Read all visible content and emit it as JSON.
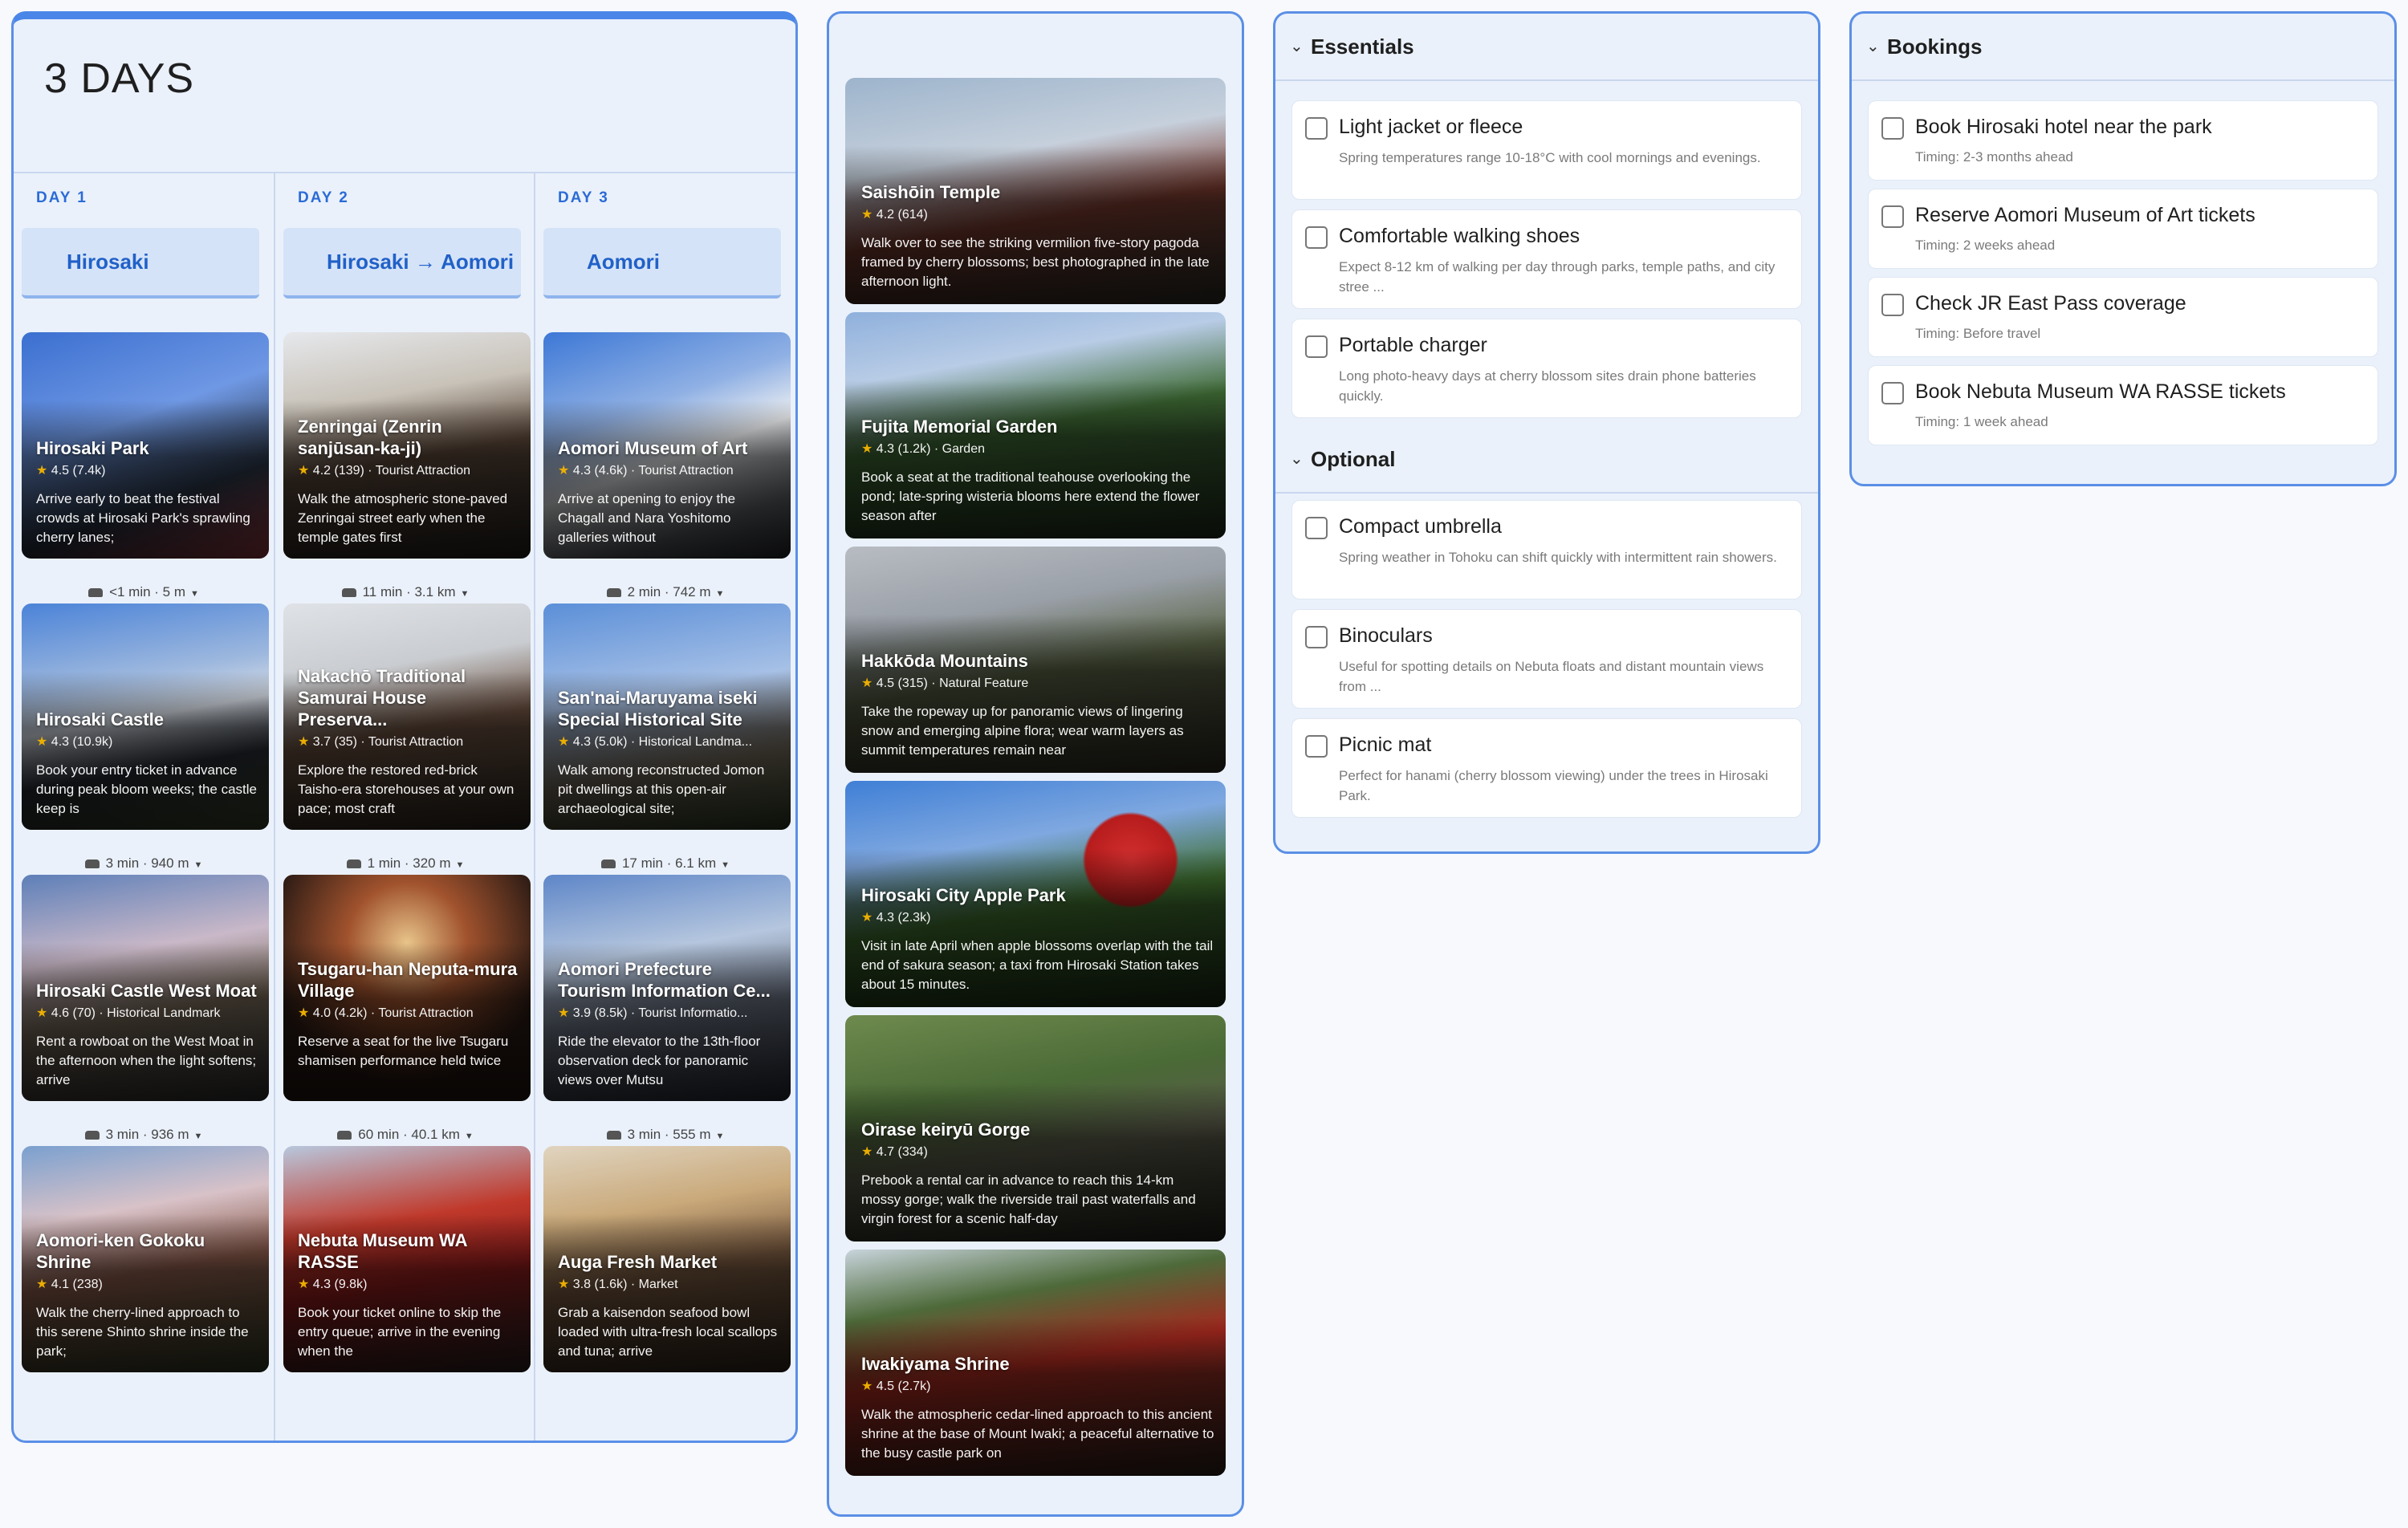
{
  "trip": {
    "title": "3 DAYS",
    "days": [
      {
        "label": "DAY 1",
        "city": "Hirosaki",
        "cards": [
          {
            "title": "Hirosaki Park",
            "rating": "4.5",
            "reviews": "(7.4k)",
            "category": "",
            "desc": "Arrive early to beat the festival crowds at Hirosaki Park's sprawling cherry lanes;"
          },
          {
            "title": "Hirosaki Castle",
            "rating": "4.3",
            "reviews": "(10.9k)",
            "category": "",
            "desc": "Book your entry ticket in advance during peak bloom weeks; the castle keep is"
          },
          {
            "title": "Hirosaki Castle West Moat",
            "rating": "4.6",
            "reviews": "(70)",
            "category": "Historical Landmark",
            "desc": "Rent a rowboat on the West Moat in the afternoon when the light softens; arrive"
          },
          {
            "title": "Aomori-ken Gokoku Shrine",
            "rating": "4.1",
            "reviews": "(238)",
            "category": "",
            "desc": "Walk the cherry-lined approach to this serene Shinto shrine inside the park;"
          }
        ],
        "travel": [
          "<1 min · 5 m",
          "3 min · 940 m",
          "3 min · 936 m"
        ]
      },
      {
        "label": "DAY 2",
        "city": "Hirosaki → Aomori",
        "cards": [
          {
            "title": "Zenringai (Zenrin sanjūsan-ka-ji)",
            "rating": "4.2",
            "reviews": "(139)",
            "category": "Tourist Attraction",
            "desc": "Walk the atmospheric stone-paved Zenringai street early when the temple gates first"
          },
          {
            "title": "Nakachō Traditional Samurai House Preserva...",
            "rating": "3.7",
            "reviews": "(35)",
            "category": "Tourist Attraction",
            "desc": "Explore the restored red-brick Taisho-era storehouses at your own pace; most craft"
          },
          {
            "title": "Tsugaru-han Neputa-mura Village",
            "rating": "4.0",
            "reviews": "(4.2k)",
            "category": "Tourist Attraction",
            "desc": "Reserve a seat for the live Tsugaru shamisen performance held twice"
          },
          {
            "title": "Nebuta Museum WA RASSE",
            "rating": "4.3",
            "reviews": "(9.8k)",
            "category": "",
            "desc": "Book your ticket online to skip the entry queue; arrive in the evening when the"
          }
        ],
        "travel": [
          "11 min · 3.1 km",
          "1 min · 320 m",
          "60 min · 40.1 km"
        ]
      },
      {
        "label": "DAY 3",
        "city": "Aomori",
        "cards": [
          {
            "title": "Aomori Museum of Art",
            "rating": "4.3",
            "reviews": "(4.6k)",
            "category": "Tourist Attraction",
            "desc": "Arrive at opening to enjoy the Chagall and Nara Yoshitomo galleries without"
          },
          {
            "title": "San'nai-Maruyama iseki Special Historical Site",
            "rating": "4.3",
            "reviews": "(5.0k)",
            "category": "Historical Landma...",
            "desc": "Walk among reconstructed Jomon pit dwellings at this open-air archaeological site;"
          },
          {
            "title": "Aomori Prefecture Tourism Information Ce...",
            "rating": "3.9",
            "reviews": "(8.5k)",
            "category": "Tourist Informatio...",
            "desc": "Ride the elevator to the 13th-floor observation deck for panoramic views over Mutsu"
          },
          {
            "title": "Auga Fresh Market",
            "rating": "3.8",
            "reviews": "(1.6k)",
            "category": "Market",
            "desc": "Grab a kaisendon seafood bowl loaded with ultra-fresh local scallops and tuna; arrive"
          }
        ],
        "travel": [
          "2 min · 742 m",
          "17 min · 6.1 km",
          "3 min · 555 m"
        ]
      }
    ]
  },
  "gallery": [
    {
      "title": "Saishōin Temple",
      "rating": "4.2",
      "reviews": "(614)",
      "category": "",
      "desc": "Walk over to see the striking vermilion five-story pagoda framed by cherry blossoms; best photographed in the late afternoon light."
    },
    {
      "title": "Fujita Memorial Garden",
      "rating": "4.3",
      "reviews": "(1.2k)",
      "category": "Garden",
      "desc": "Book a seat at the traditional teahouse overlooking the pond; late-spring wisteria blooms here extend the flower season after"
    },
    {
      "title": "Hakkōda Mountains",
      "rating": "4.5",
      "reviews": "(315)",
      "category": "Natural Feature",
      "desc": "Take the ropeway up for panoramic views of lingering snow and emerging alpine flora; wear warm layers as summit temperatures remain near"
    },
    {
      "title": "Hirosaki City Apple Park",
      "rating": "4.3",
      "reviews": "(2.3k)",
      "category": "",
      "desc": "Visit in late April when apple blossoms overlap with the tail end of sakura season; a taxi from Hirosaki Station takes about 15 minutes."
    },
    {
      "title": "Oirase keiryū Gorge",
      "rating": "4.7",
      "reviews": "(334)",
      "category": "",
      "desc": "Prebook a rental car in advance to reach this 14-km mossy gorge; walk the riverside trail past waterfalls and virgin forest for a scenic half-day"
    },
    {
      "title": "Iwakiyama Shrine",
      "rating": "4.5",
      "reviews": "(2.7k)",
      "category": "",
      "desc": "Walk the atmospheric cedar-lined approach to this ancient shrine at the base of Mount Iwaki; a peaceful alternative to the busy castle park on"
    }
  ],
  "checklist": {
    "essentials_label": "Essentials",
    "optional_label": "Optional",
    "essentials": [
      {
        "name": "Light jacket or fleece",
        "note": "Spring temperatures range 10-18°C with cool mornings and evenings."
      },
      {
        "name": "Comfortable walking shoes",
        "note": "Expect 8-12 km of walking per day through parks, temple paths, and city stree ..."
      },
      {
        "name": "Portable charger",
        "note": "Long photo-heavy days at cherry blossom sites drain phone batteries quickly."
      }
    ],
    "optional": [
      {
        "name": "Compact umbrella",
        "note": "Spring weather in Tohoku can shift quickly with intermittent rain showers."
      },
      {
        "name": "Binoculars",
        "note": "Useful for spotting details on Nebuta floats and distant mountain views from ..."
      },
      {
        "name": "Picnic mat",
        "note": "Perfect for hanami (cherry blossom viewing) under the trees in Hirosaki Park."
      }
    ]
  },
  "bookings": {
    "label": "Bookings",
    "items": [
      {
        "name": "Book Hirosaki hotel near the park",
        "note": "Timing: 2-3 months ahead"
      },
      {
        "name": "Reserve Aomori Museum of Art tickets",
        "note": "Timing: 2 weeks ahead"
      },
      {
        "name": "Check JR East Pass coverage",
        "note": "Timing: Before travel"
      },
      {
        "name": "Book Nebuta Museum WA RASSE tickets",
        "note": "Timing: 1 week ahead"
      }
    ]
  },
  "colors": {
    "accent": "#2b6bd6",
    "panel_bg": "#eaf1fb",
    "border": "#5b8fe6",
    "star": "#f4b400"
  }
}
